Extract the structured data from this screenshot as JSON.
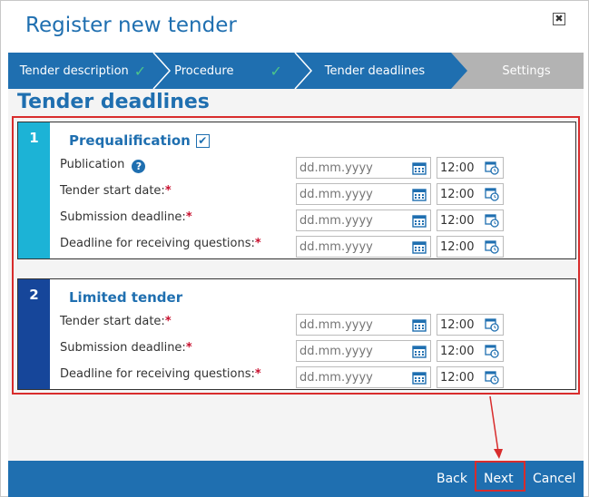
{
  "dialog": {
    "title": "Register new tender",
    "close_glyph": "✖"
  },
  "wizard": {
    "steps": [
      {
        "label": "Tender description",
        "state": "done"
      },
      {
        "label": "Procedure",
        "state": "done"
      },
      {
        "label": "Tender deadlines",
        "state": "active"
      },
      {
        "label": "Settings",
        "state": "pending"
      }
    ],
    "check_glyph": "✓"
  },
  "section_title": "Tender deadlines",
  "prequalification": {
    "number": "1",
    "heading": "Prequalification",
    "checked": true,
    "check_glyph": "✔",
    "rows": [
      {
        "label": "Publication",
        "required": false,
        "help": true,
        "date_placeholder": "dd.mm.yyyy",
        "time": "12:00"
      },
      {
        "label": "Tender start date:",
        "required": true,
        "help": false,
        "date_placeholder": "dd.mm.yyyy",
        "time": "12:00"
      },
      {
        "label": "Submission deadline:",
        "required": true,
        "help": false,
        "date_placeholder": "dd.mm.yyyy",
        "time": "12:00"
      },
      {
        "label": "Deadline for receiving questions:",
        "required": true,
        "help": false,
        "date_placeholder": "dd.mm.yyyy",
        "time": "12:00"
      }
    ]
  },
  "limited": {
    "number": "2",
    "heading": "Limited tender",
    "rows": [
      {
        "label": "Tender start date:",
        "required": true,
        "date_placeholder": "dd.mm.yyyy",
        "time": "12:00"
      },
      {
        "label": "Submission deadline:",
        "required": true,
        "date_placeholder": "dd.mm.yyyy",
        "time": "12:00"
      },
      {
        "label": "Deadline for receiving questions:",
        "required": true,
        "date_placeholder": "dd.mm.yyyy",
        "time": "12:00"
      }
    ]
  },
  "required_mark": "*",
  "help_glyph": "?",
  "footer": {
    "back_label": "Back",
    "next_label": "Next",
    "cancel_label": "Cancel"
  },
  "colors": {
    "brand": "#1f6fb0",
    "block1_accent": "#1cb3d6",
    "block2_accent": "#16469a",
    "highlight": "#d82c2c",
    "check": "#4cc48a"
  }
}
